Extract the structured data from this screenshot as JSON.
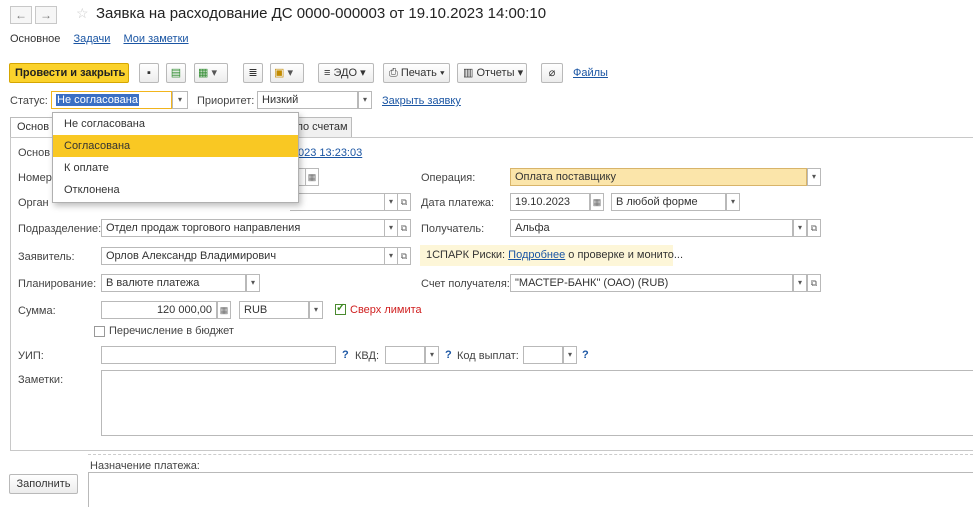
{
  "nav": {
    "back": "←",
    "forward": "→",
    "star": "☆"
  },
  "window": {
    "title": "Заявка на расходование ДС 0000-000003 от 19.10.2023 14:00:10"
  },
  "top_tabs": {
    "main": "Основное",
    "tasks": "Задачи",
    "notes": "Мои заметки"
  },
  "toolbar": {
    "post_close": "Провести и закрыть",
    "edo": "ЭДО",
    "print": "Печать",
    "reports": "Отчеты",
    "files": "Файлы"
  },
  "status": {
    "label": "Статус:",
    "value": "Не согласована",
    "priority_label": "Приоритет:",
    "priority_value": "Низкий",
    "close_link": "Закрыть заявку"
  },
  "status_dropdown": {
    "options": [
      "Не согласована",
      "Согласована",
      "К оплате",
      "Отклонена"
    ],
    "selected_index": 1
  },
  "inner_tabs": {
    "main_partial": "Основ",
    "accounts_partial": "по счетам"
  },
  "form": {
    "basis_label_partial": "Основ",
    "basis_link_partial": "023 13:23:03",
    "number_label_partial": "Номер",
    "org_label_partial": "Орган",
    "org_value_partial": "",
    "subdivision_label": "Подразделение:",
    "subdivision_value": "Отдел продаж торгового направления",
    "applicant_label": "Заявитель:",
    "applicant_value": "Орлов Александр Владимирович",
    "planning_label": "Планирование:",
    "planning_value": "В валюте платежа",
    "sum_label": "Сумма:",
    "sum_value": "120 000,00",
    "currency": "RUB",
    "over_limit": "Сверх лимита",
    "budget_transfer": "Перечисление в бюджет",
    "uip_label": "УИП:",
    "kvd_label": "КВД:",
    "pay_code_label": "Код выплат:",
    "notes_label": "Заметки:",
    "operation_label": "Операция:",
    "operation_value": "Оплата поставщику",
    "pay_date_label": "Дата платежа:",
    "pay_date_value": "19.10.2023",
    "pay_form_value": "В любой форме",
    "recipient_label": "Получатель:",
    "recipient_value": "Альфа",
    "spark_prefix": "1СПАРК Риски:",
    "spark_link": "Подробнее",
    "spark_suffix": "о проверке и монито...",
    "recipient_account_label": "Счет получателя:",
    "recipient_account_value": "\"МАСТЕР-БАНК\" (ОАО) (RUB)",
    "purpose_label": "Назначение платежа:",
    "fill_button": "Заполнить",
    "question": "?"
  }
}
